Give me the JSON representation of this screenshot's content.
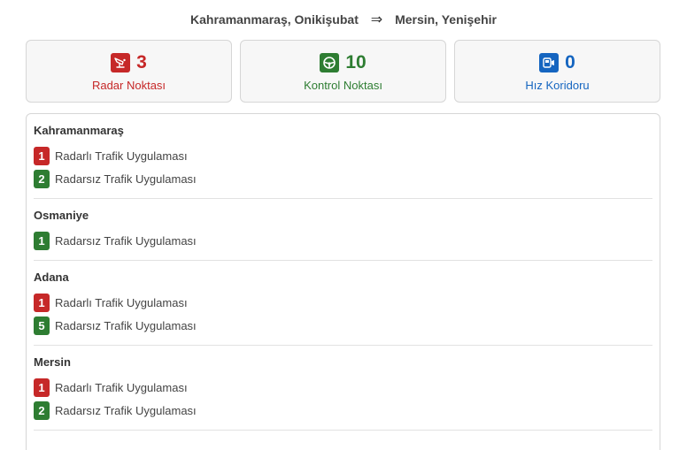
{
  "route": {
    "origin": "Kahramanmaraş, Onikişubat",
    "arrow": "⇒",
    "destination": "Mersin, Yenişehir"
  },
  "summary": {
    "radar": {
      "count": "3",
      "label": "Radar Noktası",
      "icon": "radar-camera-icon",
      "color": "#c62828"
    },
    "control": {
      "count": "10",
      "label": "Kontrol Noktası",
      "icon": "steering-wheel-icon",
      "color": "#2e7d32"
    },
    "corridor": {
      "count": "0",
      "label": "Hız Koridoru",
      "icon": "speed-corridor-icon",
      "color": "#1565c0"
    }
  },
  "regions": [
    {
      "name": "Kahramanmaraş",
      "entries": [
        {
          "count": "1",
          "label": "Radarlı Trafik Uygulaması",
          "type": "red"
        },
        {
          "count": "2",
          "label": "Radarsız Trafik Uygulaması",
          "type": "green"
        }
      ]
    },
    {
      "name": "Osmaniye",
      "entries": [
        {
          "count": "1",
          "label": "Radarsız Trafik Uygulaması",
          "type": "green"
        }
      ]
    },
    {
      "name": "Adana",
      "entries": [
        {
          "count": "1",
          "label": "Radarlı Trafik Uygulaması",
          "type": "red"
        },
        {
          "count": "5",
          "label": "Radarsız Trafik Uygulaması",
          "type": "green"
        }
      ]
    },
    {
      "name": "Mersin",
      "entries": [
        {
          "count": "1",
          "label": "Radarlı Trafik Uygulaması",
          "type": "red"
        },
        {
          "count": "2",
          "label": "Radarsız Trafik Uygulaması",
          "type": "green"
        }
      ]
    }
  ]
}
